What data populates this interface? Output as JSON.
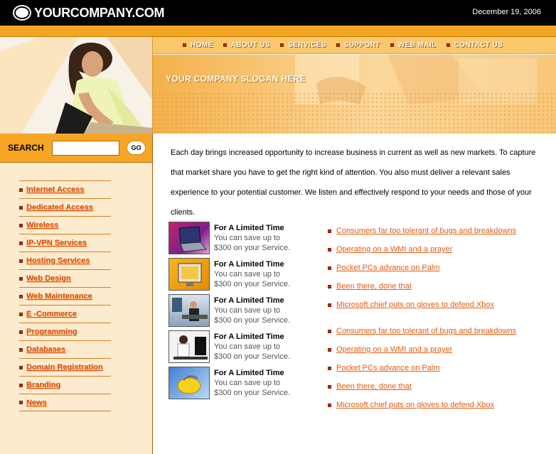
{
  "header": {
    "logo_text": "YOURCOMPANY.COM",
    "date": "December 19, 2006"
  },
  "nav": {
    "items": [
      {
        "label": "HOME"
      },
      {
        "label": "ABOUT US"
      },
      {
        "label": "SERVICES"
      },
      {
        "label": "SUPPORT"
      },
      {
        "label": "WEB MAIL"
      },
      {
        "label": "CONTACT US"
      }
    ]
  },
  "banner": {
    "slogan": "YOUR COMPANY SLOGAN HERE"
  },
  "search": {
    "label": "SEARCH",
    "value": "",
    "button_label": "GO"
  },
  "sidebar": {
    "items": [
      {
        "label": "Internet Access"
      },
      {
        "label": "Dedicated Access"
      },
      {
        "label": "Wireless"
      },
      {
        "label": "IP-VPN Services"
      },
      {
        "label": "Hosting Services"
      },
      {
        "label": "Web Design"
      },
      {
        "label": "Web Maintenance"
      },
      {
        "label": "E -Commerce"
      },
      {
        "label": "Programming"
      },
      {
        "label": "Databases"
      },
      {
        "label": "Domain Registration"
      },
      {
        "label": "Branding"
      },
      {
        "label": "News"
      }
    ]
  },
  "main": {
    "intro": "Each day brings increased opportunity to increase business in current as well as new markets. To capture that market share you have to get the right kind of attention. You also must deliver a relevant sales experience to your potential customer. We listen and effectively respond to your needs and those of your clients.",
    "promos": [
      {
        "title": "For A Limited Time",
        "desc": "You can save up to $300 on your Service.",
        "icon": "laptop-thumb"
      },
      {
        "title": "For A Limited Time",
        "desc": "You can save up to $300 on your Service.",
        "icon": "monitor-thumb"
      },
      {
        "title": "For A Limited Time",
        "desc": "You can save up to $300 on your Service.",
        "icon": "office-thumb"
      },
      {
        "title": "For A Limited Time",
        "desc": "You can save up to $300 on your Service.",
        "icon": "call-center-thumb"
      },
      {
        "title": "For A Limited Time",
        "desc": "You can save up to $300 on your Service.",
        "icon": "mouse-thumb"
      }
    ],
    "news": [
      {
        "label": "Consumers far too tolerant of bugs and breakdowns"
      },
      {
        "label": "Operating on a WMI and a prayer"
      },
      {
        "label": "Pocket PCs advance on Palm"
      },
      {
        "label": "Been there, done that"
      },
      {
        "label": "Microsoft chief puts on gloves to defend Xbox"
      },
      {
        "label": "Consumers far too tolerant of bugs and breakdowns"
      },
      {
        "label": "Operating on a WMI and a prayer"
      },
      {
        "label": "Pocket PCs advance on Palm"
      },
      {
        "label": "Been there, done that"
      },
      {
        "label": "Microsoft chief puts on gloves to defend Xbox"
      }
    ]
  },
  "colors": {
    "header_bg": "#000000",
    "accent_orange": "#f3a521",
    "sidebar_bg": "#fdebd0",
    "link": "#e35a10"
  }
}
